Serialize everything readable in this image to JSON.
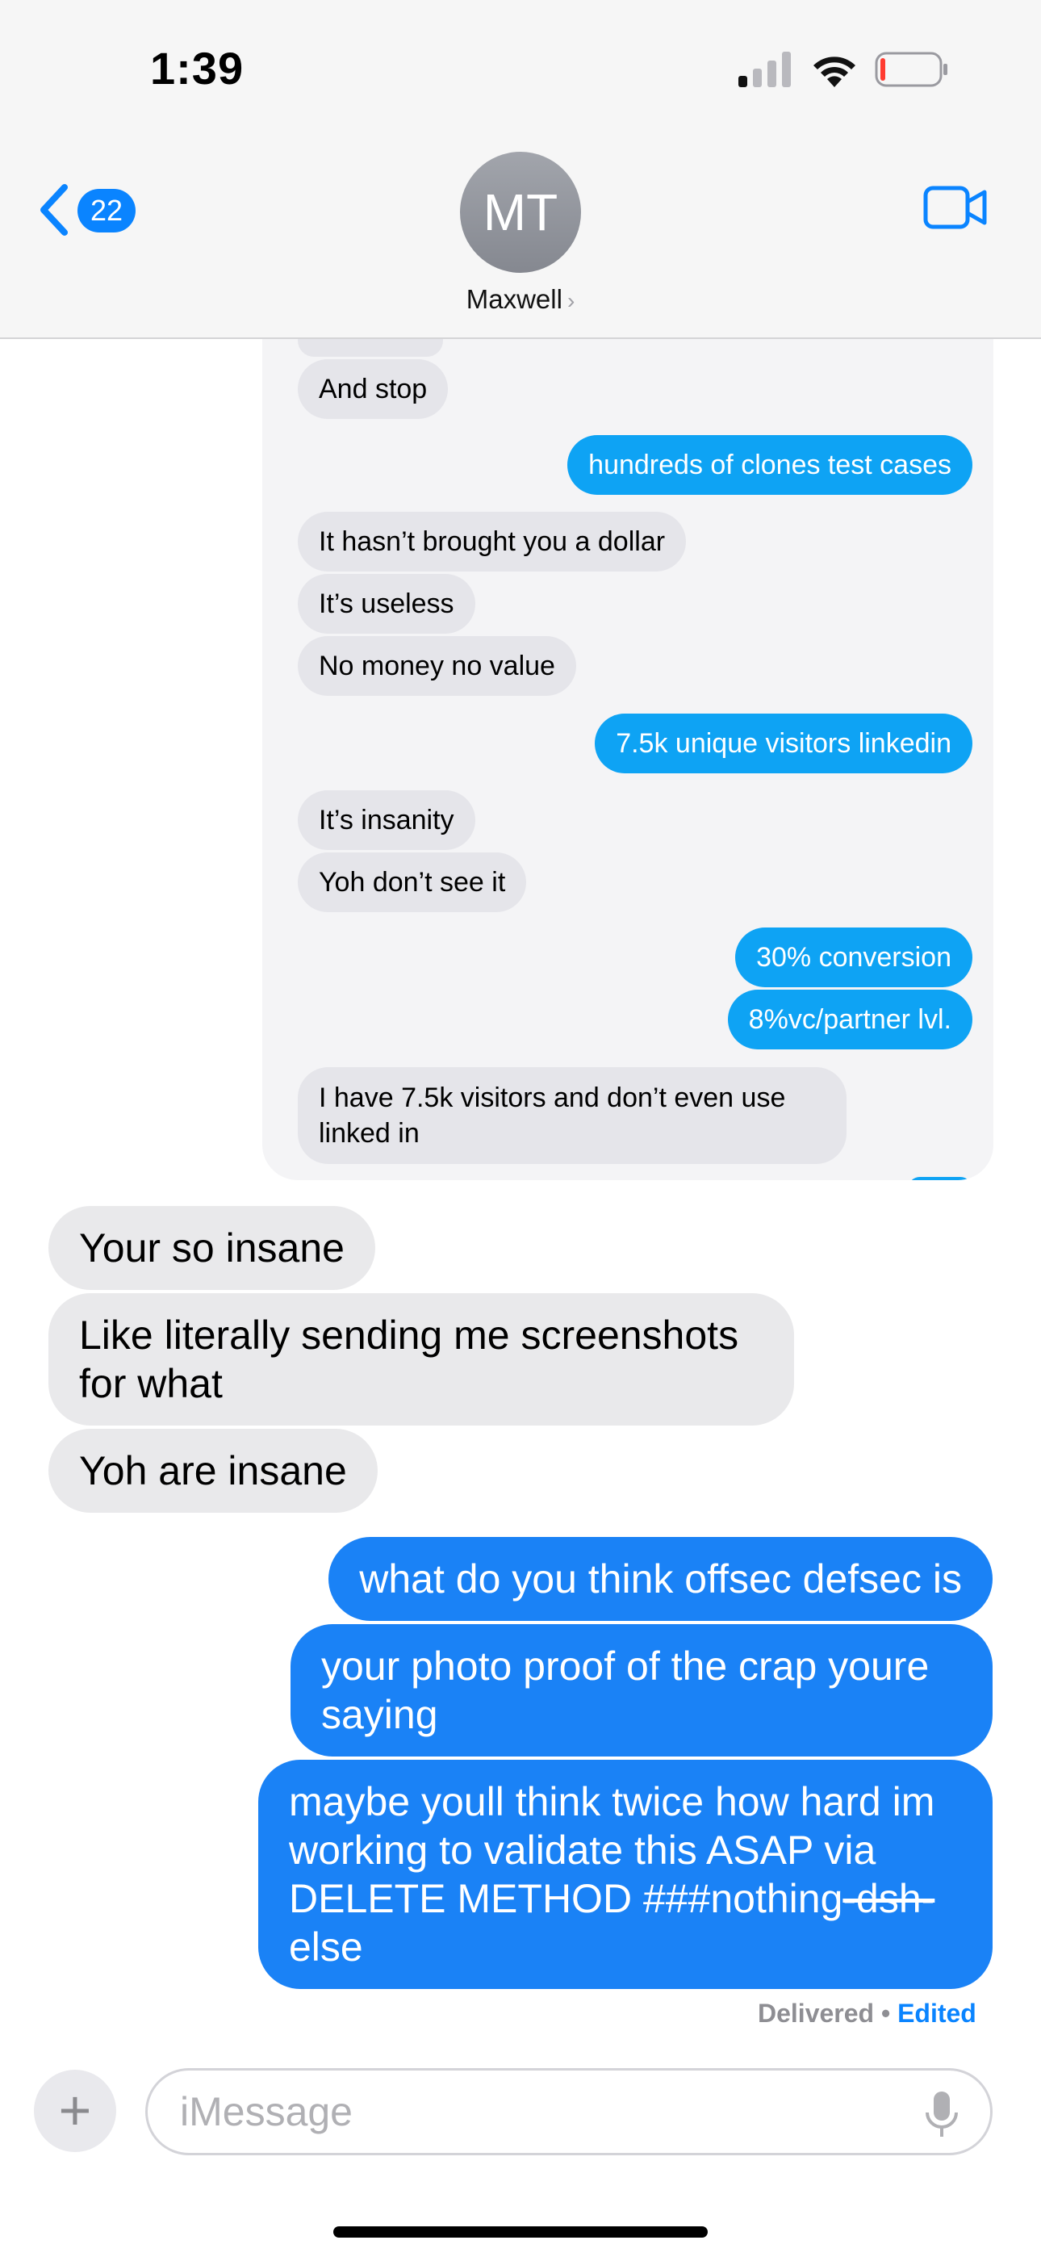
{
  "status_bar": {
    "time": "1:39"
  },
  "header": {
    "back_count": "22",
    "avatar_initials": "MT",
    "contact_name": "Maxwell",
    "contact_chevron": "›",
    "video_icon": "video-camera-icon"
  },
  "screenshot_thread": {
    "messages": [
      {
        "sender": "them",
        "text": "And stop"
      },
      {
        "sender": "me",
        "text": "hundreds of clones test cases"
      },
      {
        "sender": "them",
        "text": "It hasn’t brought you a dollar"
      },
      {
        "sender": "them",
        "text": "It’s useless"
      },
      {
        "sender": "them",
        "text": "No money no value"
      },
      {
        "sender": "me",
        "text": "7.5k unique visitors linkedin"
      },
      {
        "sender": "them",
        "text": "It’s insanity"
      },
      {
        "sender": "them",
        "text": "Yoh don’t see it"
      },
      {
        "sender": "me",
        "text": "30% conversion"
      },
      {
        "sender": "me",
        "text": "8%vc/partner lvl."
      },
      {
        "sender": "them",
        "text": "I have 7.5k visitors and don’t even use linked in"
      }
    ]
  },
  "thread": {
    "messages": [
      {
        "sender": "them",
        "text": "Your so insane"
      },
      {
        "sender": "them",
        "text": "Like literally sending me screenshots for what"
      },
      {
        "sender": "them",
        "text": "Yoh are insane"
      },
      {
        "sender": "me",
        "text": "what do you think offsec defsec is"
      },
      {
        "sender": "me",
        "text": "your photo proof of the crap youre saying"
      },
      {
        "sender": "me",
        "text_before": "maybe youll think twice how hard im working to validate this ASAP via DELETE METHOD ###nothing",
        "text_struck": "-dsh-",
        "text_after": "else"
      }
    ],
    "status": "Delivered",
    "status_separator": " • ",
    "status_edited": "Edited"
  },
  "compose": {
    "placeholder": "iMessage",
    "plus_label": "+"
  },
  "colors": {
    "imessage_blue": "#1a82f6",
    "screenshot_blue": "#0ea3f4",
    "received_gray": "#e9e9eb",
    "link_blue": "#0a84ff"
  }
}
